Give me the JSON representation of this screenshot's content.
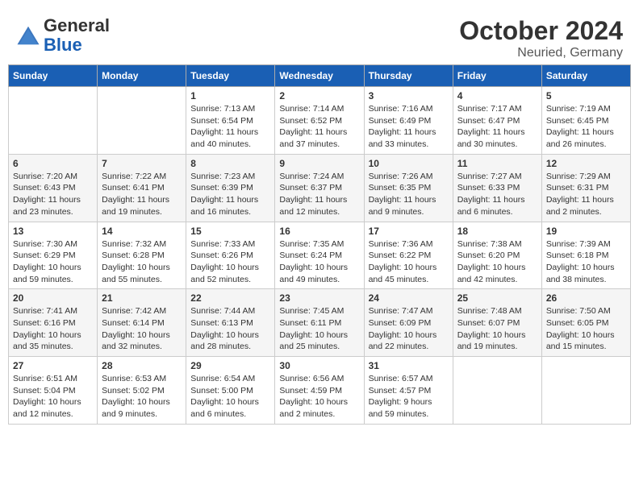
{
  "header": {
    "logo_general": "General",
    "logo_blue": "Blue",
    "month": "October 2024",
    "location": "Neuried, Germany"
  },
  "columns": [
    "Sunday",
    "Monday",
    "Tuesday",
    "Wednesday",
    "Thursday",
    "Friday",
    "Saturday"
  ],
  "weeks": [
    [
      {
        "day": "",
        "info": ""
      },
      {
        "day": "",
        "info": ""
      },
      {
        "day": "1",
        "info": "Sunrise: 7:13 AM\nSunset: 6:54 PM\nDaylight: 11 hours and 40 minutes."
      },
      {
        "day": "2",
        "info": "Sunrise: 7:14 AM\nSunset: 6:52 PM\nDaylight: 11 hours and 37 minutes."
      },
      {
        "day": "3",
        "info": "Sunrise: 7:16 AM\nSunset: 6:49 PM\nDaylight: 11 hours and 33 minutes."
      },
      {
        "day": "4",
        "info": "Sunrise: 7:17 AM\nSunset: 6:47 PM\nDaylight: 11 hours and 30 minutes."
      },
      {
        "day": "5",
        "info": "Sunrise: 7:19 AM\nSunset: 6:45 PM\nDaylight: 11 hours and 26 minutes."
      }
    ],
    [
      {
        "day": "6",
        "info": "Sunrise: 7:20 AM\nSunset: 6:43 PM\nDaylight: 11 hours and 23 minutes."
      },
      {
        "day": "7",
        "info": "Sunrise: 7:22 AM\nSunset: 6:41 PM\nDaylight: 11 hours and 19 minutes."
      },
      {
        "day": "8",
        "info": "Sunrise: 7:23 AM\nSunset: 6:39 PM\nDaylight: 11 hours and 16 minutes."
      },
      {
        "day": "9",
        "info": "Sunrise: 7:24 AM\nSunset: 6:37 PM\nDaylight: 11 hours and 12 minutes."
      },
      {
        "day": "10",
        "info": "Sunrise: 7:26 AM\nSunset: 6:35 PM\nDaylight: 11 hours and 9 minutes."
      },
      {
        "day": "11",
        "info": "Sunrise: 7:27 AM\nSunset: 6:33 PM\nDaylight: 11 hours and 6 minutes."
      },
      {
        "day": "12",
        "info": "Sunrise: 7:29 AM\nSunset: 6:31 PM\nDaylight: 11 hours and 2 minutes."
      }
    ],
    [
      {
        "day": "13",
        "info": "Sunrise: 7:30 AM\nSunset: 6:29 PM\nDaylight: 10 hours and 59 minutes."
      },
      {
        "day": "14",
        "info": "Sunrise: 7:32 AM\nSunset: 6:28 PM\nDaylight: 10 hours and 55 minutes."
      },
      {
        "day": "15",
        "info": "Sunrise: 7:33 AM\nSunset: 6:26 PM\nDaylight: 10 hours and 52 minutes."
      },
      {
        "day": "16",
        "info": "Sunrise: 7:35 AM\nSunset: 6:24 PM\nDaylight: 10 hours and 49 minutes."
      },
      {
        "day": "17",
        "info": "Sunrise: 7:36 AM\nSunset: 6:22 PM\nDaylight: 10 hours and 45 minutes."
      },
      {
        "day": "18",
        "info": "Sunrise: 7:38 AM\nSunset: 6:20 PM\nDaylight: 10 hours and 42 minutes."
      },
      {
        "day": "19",
        "info": "Sunrise: 7:39 AM\nSunset: 6:18 PM\nDaylight: 10 hours and 38 minutes."
      }
    ],
    [
      {
        "day": "20",
        "info": "Sunrise: 7:41 AM\nSunset: 6:16 PM\nDaylight: 10 hours and 35 minutes."
      },
      {
        "day": "21",
        "info": "Sunrise: 7:42 AM\nSunset: 6:14 PM\nDaylight: 10 hours and 32 minutes."
      },
      {
        "day": "22",
        "info": "Sunrise: 7:44 AM\nSunset: 6:13 PM\nDaylight: 10 hours and 28 minutes."
      },
      {
        "day": "23",
        "info": "Sunrise: 7:45 AM\nSunset: 6:11 PM\nDaylight: 10 hours and 25 minutes."
      },
      {
        "day": "24",
        "info": "Sunrise: 7:47 AM\nSunset: 6:09 PM\nDaylight: 10 hours and 22 minutes."
      },
      {
        "day": "25",
        "info": "Sunrise: 7:48 AM\nSunset: 6:07 PM\nDaylight: 10 hours and 19 minutes."
      },
      {
        "day": "26",
        "info": "Sunrise: 7:50 AM\nSunset: 6:05 PM\nDaylight: 10 hours and 15 minutes."
      }
    ],
    [
      {
        "day": "27",
        "info": "Sunrise: 6:51 AM\nSunset: 5:04 PM\nDaylight: 10 hours and 12 minutes."
      },
      {
        "day": "28",
        "info": "Sunrise: 6:53 AM\nSunset: 5:02 PM\nDaylight: 10 hours and 9 minutes."
      },
      {
        "day": "29",
        "info": "Sunrise: 6:54 AM\nSunset: 5:00 PM\nDaylight: 10 hours and 6 minutes."
      },
      {
        "day": "30",
        "info": "Sunrise: 6:56 AM\nSunset: 4:59 PM\nDaylight: 10 hours and 2 minutes."
      },
      {
        "day": "31",
        "info": "Sunrise: 6:57 AM\nSunset: 4:57 PM\nDaylight: 9 hours and 59 minutes."
      },
      {
        "day": "",
        "info": ""
      },
      {
        "day": "",
        "info": ""
      }
    ]
  ]
}
